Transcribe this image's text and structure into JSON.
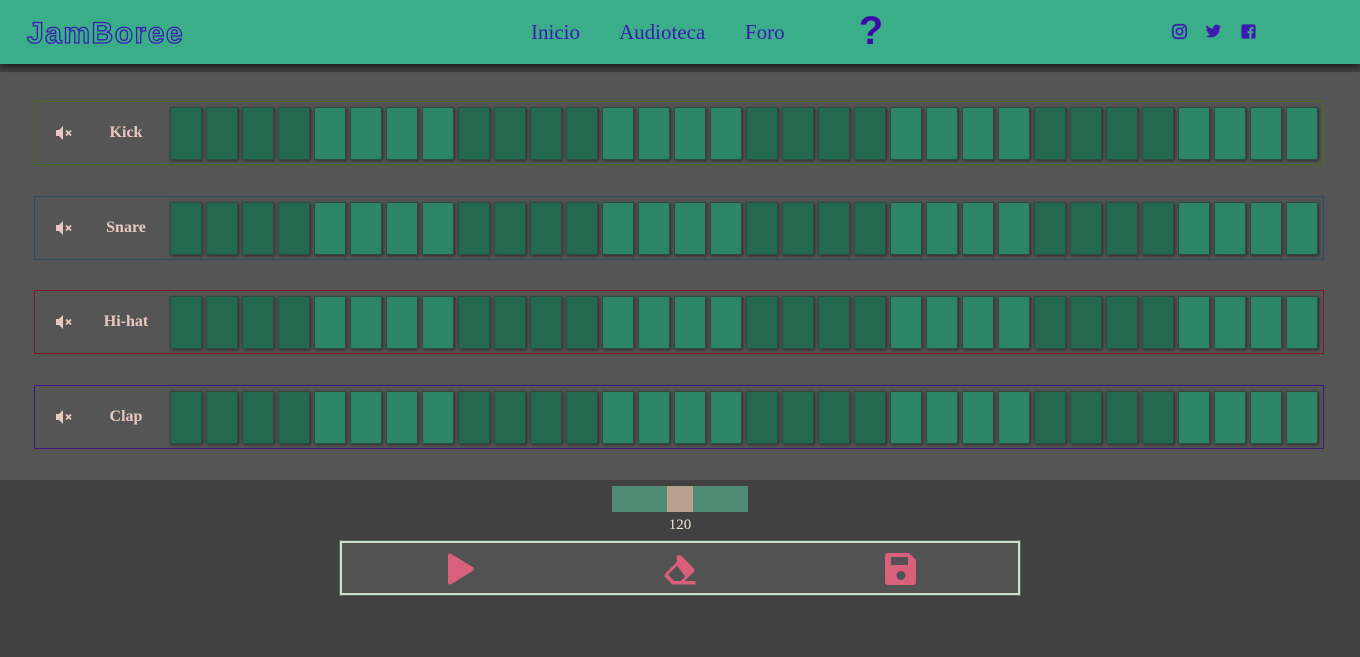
{
  "header": {
    "logo_text": "JamBoree",
    "nav": [
      "Inicio",
      "Audioteca",
      "Foro"
    ],
    "help_label": "?",
    "social_icons": [
      "instagram-icon",
      "twitter-icon",
      "facebook-icon"
    ]
  },
  "colors": {
    "header_bg": "#3aae89",
    "nav_text": "#3d1ab2",
    "pad_dark": "#23694f",
    "pad_light": "#2c8566",
    "control_icon": "#d9607b"
  },
  "tracks": [
    {
      "name": "Kick",
      "icon": "mute-icon"
    },
    {
      "name": "Snare",
      "icon": "mute-icon"
    },
    {
      "name": "Hi-hat",
      "icon": "mute-icon"
    },
    {
      "name": "Clap",
      "icon": "mute-icon"
    }
  ],
  "steps_per_track": 32,
  "tempo": {
    "value": "120"
  },
  "controls": [
    "play-icon",
    "eraser-icon",
    "save-icon"
  ]
}
